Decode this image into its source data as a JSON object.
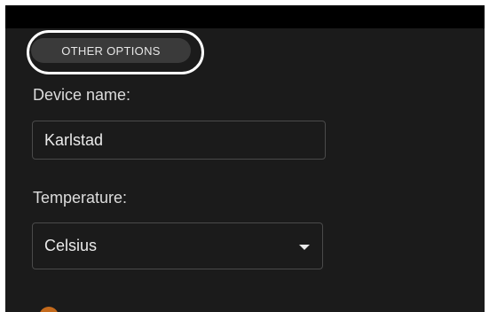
{
  "options_button": {
    "label": "OTHER OPTIONS"
  },
  "device": {
    "label": "Device name:",
    "value": "Karlstad"
  },
  "temperature": {
    "label": "Temperature:",
    "value": "Celsius"
  },
  "icons": {
    "dropdown": "chevron-down-icon",
    "partial": "app-icon"
  },
  "colors": {
    "background": "#1b1b1b",
    "chip": "#3a3a3a",
    "highlight": "#ffffff",
    "text": "#eaeaea"
  }
}
